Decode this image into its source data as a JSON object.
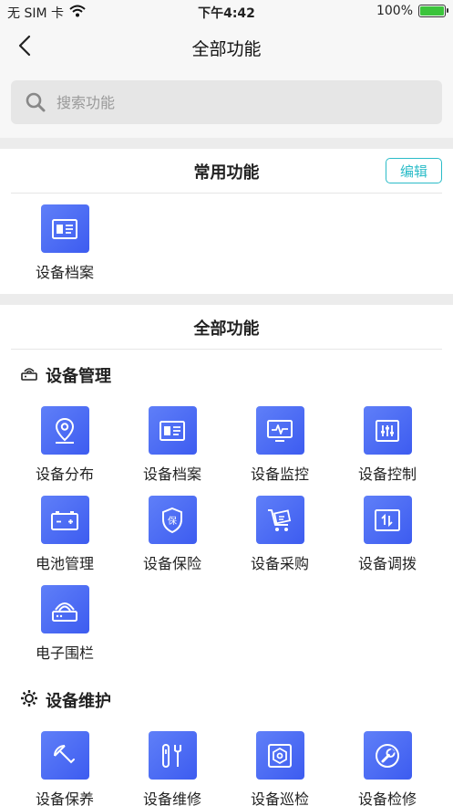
{
  "status_bar": {
    "carrier": "无 SIM 卡",
    "time": "下午4:42",
    "battery": "100%",
    "battery_level": 1.0
  },
  "nav": {
    "title": "全部功能",
    "back_icon": "chevron-left-icon"
  },
  "search": {
    "placeholder": "搜索功能",
    "value": ""
  },
  "common": {
    "title": "常用功能",
    "edit_label": "编辑",
    "items": [
      {
        "label": "设备档案",
        "icon": "archive-card-icon"
      }
    ]
  },
  "all": {
    "title": "全部功能",
    "sections": [
      {
        "title": "设备管理",
        "icon": "router-icon",
        "items": [
          {
            "label": "设备分布",
            "icon": "location-pin-icon"
          },
          {
            "label": "设备档案",
            "icon": "archive-card-icon"
          },
          {
            "label": "设备监控",
            "icon": "monitor-pulse-icon"
          },
          {
            "label": "设备控制",
            "icon": "sliders-icon"
          },
          {
            "label": "电池管理",
            "icon": "battery-icon"
          },
          {
            "label": "设备保险",
            "icon": "insurance-shield-icon"
          },
          {
            "label": "设备采购",
            "icon": "purchase-cart-icon"
          },
          {
            "label": "设备调拨",
            "icon": "transfer-icon"
          },
          {
            "label": "电子围栏",
            "icon": "fence-signal-icon"
          }
        ]
      },
      {
        "title": "设备维护",
        "icon": "gear-icon",
        "items": [
          {
            "label": "设备保养",
            "icon": "maintenance-umbrella-icon"
          },
          {
            "label": "设备维修",
            "icon": "repair-tools-icon"
          },
          {
            "label": "设备巡检",
            "icon": "inspection-hex-icon"
          },
          {
            "label": "设备检修",
            "icon": "wrench-circle-icon"
          }
        ]
      }
    ]
  }
}
